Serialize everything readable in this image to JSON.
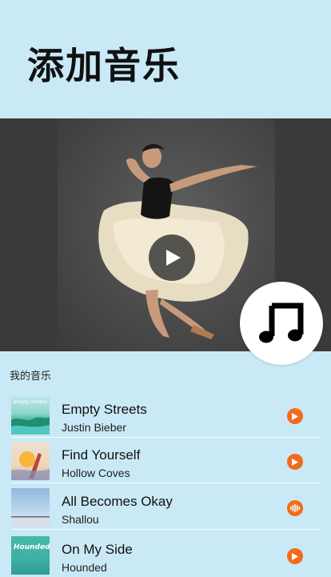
{
  "header": {
    "title": "添加音乐"
  },
  "video": {
    "play_icon": "play-icon"
  },
  "fab": {
    "icon": "music-note-icon"
  },
  "section": {
    "label": "我的音乐"
  },
  "songs": [
    {
      "title": "Empty Streets",
      "artist": "Justin Bieber",
      "action": "play-icon",
      "thumb_text": "empty streets"
    },
    {
      "title": "Find Yourself",
      "artist": "Hollow  Coves",
      "action": "play-icon"
    },
    {
      "title": "All Becomes Okay",
      "artist": "Shallou",
      "action": "equalizer-icon"
    },
    {
      "title": "On My Side",
      "artist": "Hounded",
      "action": "play-icon",
      "thumb_text": "Hounded"
    }
  ],
  "colors": {
    "background": "#c9e9f6",
    "accent": "#f26b1d",
    "fab": "#ffffff"
  }
}
